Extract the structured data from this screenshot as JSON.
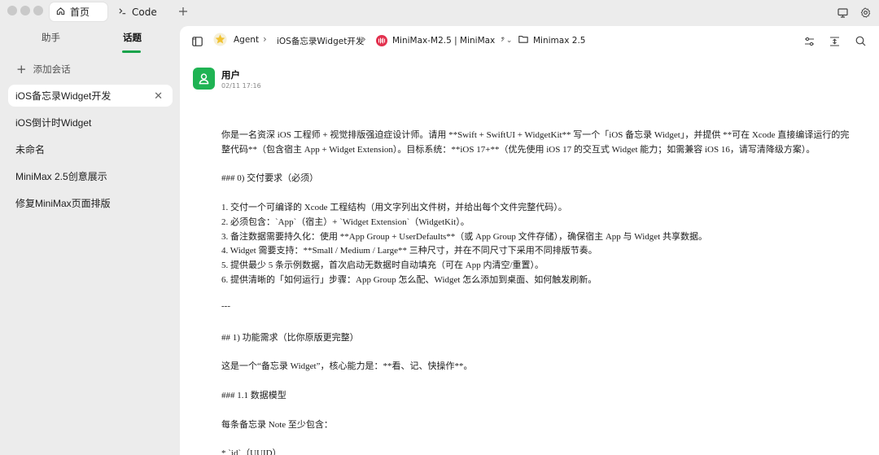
{
  "titlebar": {
    "tabs": [
      {
        "label": "首页",
        "icon": "home-icon",
        "active": true
      },
      {
        "label": "Code",
        "icon": "terminal-icon",
        "active": false
      }
    ],
    "new_tab_icon": "plus-icon",
    "right_icons": [
      "monitor-icon",
      "gear-icon"
    ]
  },
  "sidebar": {
    "tabs": [
      {
        "label": "助手",
        "active": false
      },
      {
        "label": "话题",
        "active": true
      }
    ],
    "add_label": "添加会话",
    "conversations": [
      {
        "label": "iOS备忘录Widget开发",
        "active": true
      },
      {
        "label": "iOS倒计时Widget",
        "active": false
      },
      {
        "label": "未命名",
        "active": false
      },
      {
        "label": "MiniMax 2.5创意展示",
        "active": false
      },
      {
        "label": "修复MiniMax页面排版",
        "active": false
      }
    ],
    "accent": "#17a34a"
  },
  "toolbar": {
    "agent_label": "Agent",
    "topic_label": "iOS备忘录Widget开发",
    "model_label": "MiniMax-M2.5 | MiniMax",
    "folder_label": "Minimax 2.5",
    "right_icons": [
      "sliders-icon",
      "collapse-icon",
      "search-icon"
    ]
  },
  "message": {
    "user": "用户",
    "time": "02/11 17:16",
    "avatar_color": "#1fb353",
    "lines": [
      "你是一名资深 iOS 工程师 + 视觉排版强迫症设计师。请用 **Swift + SwiftUI + WidgetKit** 写一个「iOS 备忘录 Widget」，并提供 **可在 Xcode 直接编译运行的完",
      "整代码**（包含宿主 App + Widget Extension）。目标系统：**iOS 17+**（优先使用 iOS 17 的交互式 Widget 能力；如需兼容 iOS 16，请写清降级方案）。",
      "### 0) 交付要求（必须）",
      "1. 交付一个可编译的 Xcode 工程结构（用文字列出文件树，并给出每个文件完整代码）。",
      "2. 必须包含：`App`（宿主）+ `Widget Extension`（WidgetKit）。",
      "3. 备注数据需要持久化：使用 **App Group + UserDefaults**（或 App Group 文件存储），确保宿主 App 与 Widget 共享数据。",
      "4. Widget 需要支持：**Small / Medium / Large** 三种尺寸，并在不同尺寸下采用不同排版节奏。",
      "5. 提供最少 5 条示例数据，首次启动无数据时自动填充（可在 App 内清空/重置）。",
      "6. 提供清晰的「如何运行」步骤：App Group 怎么配、Widget 怎么添加到桌面、如何触发刷新。",
      "---",
      "## 1) 功能需求（比你原版更完整）",
      "这是一个“备忘录 Widget”，核心能力是：**看、记、快操作**。",
      "### 1.1 数据模型",
      "每条备忘录 Note 至少包含：",
      "* `id`（UUID）"
    ]
  }
}
